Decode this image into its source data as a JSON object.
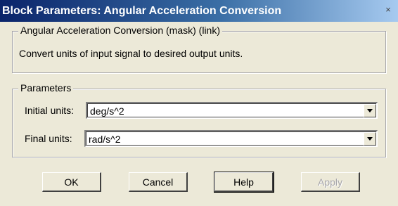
{
  "window": {
    "title": "Block Parameters: Angular Acceleration Conversion",
    "close_glyph": "×"
  },
  "description": {
    "legend": "Angular Acceleration Conversion (mask) (link)",
    "text": "Convert units of input signal to desired output units."
  },
  "parameters": {
    "legend": "Parameters",
    "initial": {
      "label": "Initial units:",
      "value": "deg/s^2"
    },
    "final": {
      "label": "Final units:",
      "value": "rad/s^2"
    }
  },
  "buttons": {
    "ok": "OK",
    "cancel": "Cancel",
    "help": "Help",
    "apply": "Apply"
  }
}
